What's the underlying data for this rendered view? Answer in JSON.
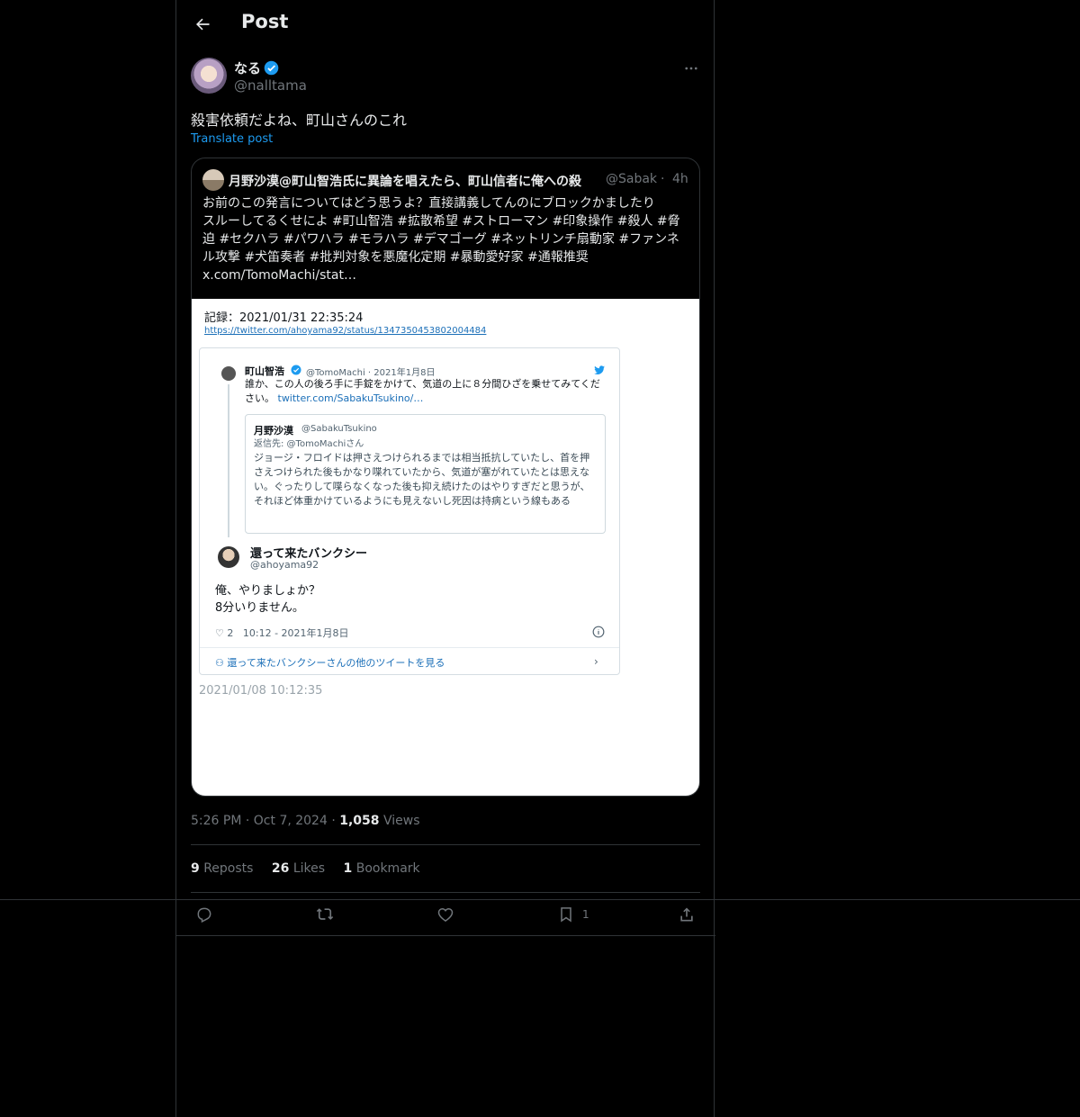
{
  "header": {
    "title": "Post"
  },
  "author": {
    "display_name": "なる",
    "handle": "@nalltama"
  },
  "post": {
    "text": "殺害依頼だよね、町山さんのこれ",
    "translate_label": "Translate post",
    "time": "5:26 PM",
    "date": "Oct 7, 2024",
    "views_count": "1,058",
    "views_label": "Views"
  },
  "quote": {
    "name": "月野沙漠@町山智浩氏に異論を唱えたら、町山信者に俺への殺",
    "handle": "@Sabak",
    "time": "4h",
    "text_lines": [
      "お前のこの発言についてはどう思うよ？直接講義してんのにブロックかましたり",
      "スルーしてるくせによ #町山智浩 #拡散希望 #ストローマン #印象操作 #殺人 #脅",
      "迫 #セクハラ #パワハラ #モラハラ #デマゴーグ #ネットリンチ扇動家 #ファンネ",
      "ル攻撃 #犬笛奏者 #批判対象を悪魔化定期 #暴動愛好家 #通報推奨",
      "x.com/TomoMachi/stat…"
    ],
    "image": {
      "record_title": "記録：2021/01/31 22:35:24",
      "record_link": "https://twitter.com/ahoyama92/status/1347350453802004484",
      "parent_name": "町山智浩",
      "parent_meta": "@TomoMachi · 2021年1月8日",
      "parent_text": "誰か、この人の後ろ手に手錠をかけて、気道の上に８分間ひざを乗せてみてください。",
      "parent_link": "twitter.com/SabakuTsukino/…",
      "inner_name": "月野沙漠",
      "inner_handle": "@SabakuTsukino",
      "inner_reply": "返信先: @TomoMachiさん",
      "inner_text": "ジョージ・フロイドは押さえつけられるまでは相当抵抗していたし、首を押さえつけられた後もかなり喋れていたから、気道が塞がれていたとは思えない。ぐったりして喋らなくなった後も抑え続けたのはやりすぎだと思うが、それほど体重かけているようにも見えないし死因は持病という線もある",
      "reply_name": "還って来たバンクシー",
      "reply_handle": "@ahoyama92",
      "reply_text_1": "俺、やりましょか？",
      "reply_text_2": "8分いりません。",
      "reply_likes": "2",
      "reply_time": "10:12 - 2021年1月8日",
      "more_tweets": "還って来たバンクシーさんの他のツイートを見る",
      "record_date": "2021/01/08 10:12:35"
    }
  },
  "stats": {
    "reposts_count": "9",
    "reposts_label": "Reposts",
    "likes_count": "26",
    "likes_label": "Likes",
    "bookmarks_count": "1",
    "bookmarks_label": "Bookmark"
  },
  "actions": {
    "bookmark_count": "1"
  },
  "colors": {
    "background": "#000000",
    "accent": "#1d9bf0",
    "muted": "#71767b",
    "border": "#2f3336"
  },
  "icons": [
    "back-arrow-icon",
    "verified-badge-icon",
    "more-icon",
    "reply-icon",
    "repost-icon",
    "like-icon",
    "bookmark-icon",
    "share-icon"
  ]
}
